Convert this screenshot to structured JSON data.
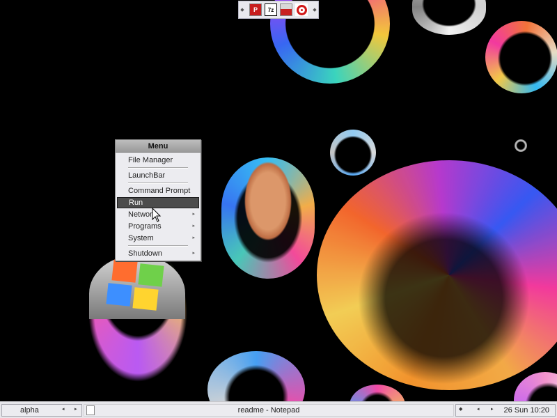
{
  "launchbar": {
    "icons": [
      "pdf-reader-icon",
      "7zip-icon",
      "toolkit-icon",
      "opera-icon"
    ],
    "icon_text": {
      "pdf": "P",
      "sevenzip": "7z"
    }
  },
  "menu": {
    "title": "Menu",
    "items": [
      {
        "label": "File Manager",
        "has_submenu": false
      },
      {
        "label": "LaunchBar",
        "has_submenu": false
      },
      {
        "label": "Command Prompt",
        "has_submenu": false
      },
      {
        "label": "Run",
        "has_submenu": false,
        "active": true
      },
      {
        "label": "Network",
        "has_submenu": true
      },
      {
        "label": "Programs",
        "has_submenu": true
      },
      {
        "label": "System",
        "has_submenu": true
      },
      {
        "label": "Shutdown",
        "has_submenu": true
      }
    ],
    "submenu_arrow": "▸"
  },
  "taskbar": {
    "workspace": "alpha",
    "task_title": "readme - Notepad",
    "clock": "26 Sun 10:20",
    "arrow_left": "◂",
    "arrow_right": "▸",
    "tray_dot": "◆"
  },
  "colors": {
    "background": "#000000",
    "menu_bg": "#ececf0",
    "menu_active": "#4c4c4c",
    "taskbar_bg": "#e6e6ea"
  }
}
